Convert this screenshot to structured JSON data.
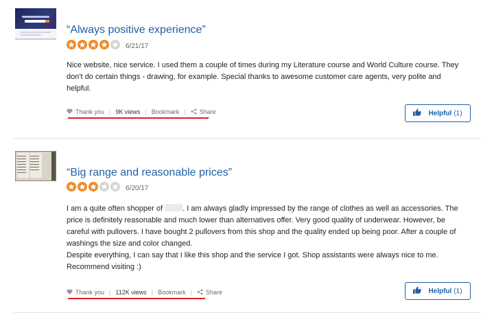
{
  "reviews": [
    {
      "title": "“Always positive experience”",
      "rating": 4,
      "rating_max": 5,
      "date": "6/21/17",
      "body_lines": [
        "Nice website, nice service. I used them a couple of times during my Literature course and World Culture course. They",
        "don't do certain things - drawing, for example. Special thanks to awesome customer care agents, very polite and",
        "helpful."
      ],
      "actions": {
        "thank_label": "Thank you",
        "views_label": "9K views",
        "bookmark_label": "Bookmark",
        "share_label": "Share"
      },
      "helpful": {
        "label": "Helpful",
        "count": "(1)"
      }
    },
    {
      "title": "“Big range and reasonable prices”",
      "rating": 3,
      "rating_max": 5,
      "date": "6/20/17",
      "body_first_prefix": "I am a quite often shopper of",
      "body_first_suffix": ". I am always gladly impressed by the range of clothes as well as accessories. The",
      "body_lines": [
        "price is definitely reasonable and much lower than alternatives offer. Very good quality of underwear. However, be",
        "careful with pullovers. I have bought 2 pullovers from this shop and the quality ended up being poor. After a couple of",
        "washings the size and color changed.",
        "Despite everything, I can say that I like this shop and the service I got. Shop assistants were always nice to me.",
        "Recommend visiting :)"
      ],
      "actions": {
        "thank_label": "Thank you",
        "views_label": "112K views",
        "bookmark_label": "Bookmark",
        "share_label": "Share"
      },
      "helpful": {
        "label": "Helpful",
        "count": "(1)"
      }
    }
  ],
  "colors": {
    "title": "#1f5fa8",
    "star_filled": "#f08a24",
    "star_empty": "#d5d5d5",
    "underline": "#e31b23",
    "helpful_border": "#1f5fa8"
  },
  "icons": {
    "like": "heart-icon",
    "share": "share-icon",
    "helpful": "thumbs-up-icon",
    "star": "star-icon"
  }
}
